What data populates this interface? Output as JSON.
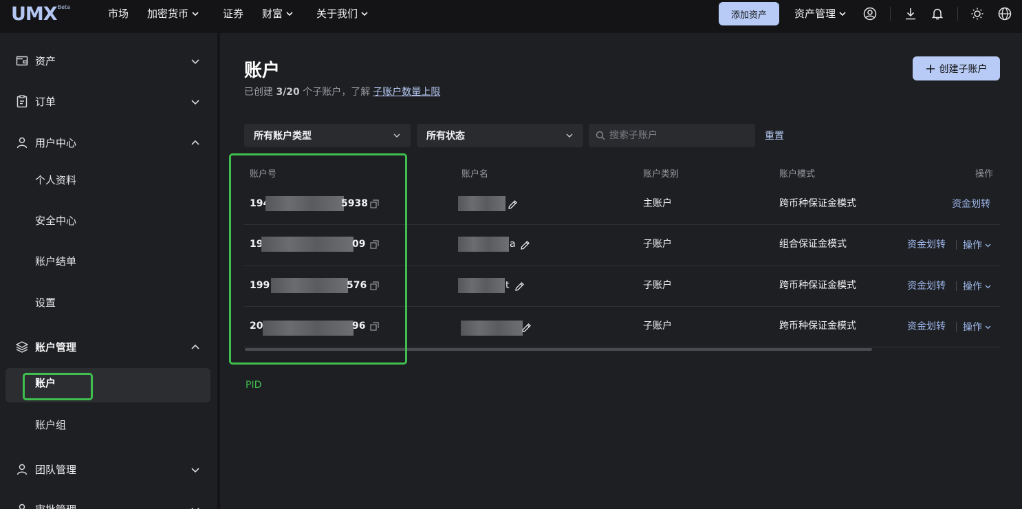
{
  "brand": {
    "logo": "UMX",
    "badge": "Beta",
    "accent": "#b7cbf6"
  },
  "topnav": {
    "items": [
      {
        "label": "市场",
        "has_dropdown": false
      },
      {
        "label": "加密货币",
        "has_dropdown": true
      },
      {
        "label": "证券",
        "has_dropdown": false
      },
      {
        "label": "财富",
        "has_dropdown": true
      },
      {
        "label": "关于我们",
        "has_dropdown": true
      }
    ],
    "add_asset_label": "添加资产",
    "asset_mgmt_label": "资产管理",
    "icons": [
      "user-icon",
      "download-icon",
      "bell-icon",
      "sun-icon",
      "globe-icon"
    ]
  },
  "sidebar": {
    "groups": [
      {
        "label": "资产",
        "icon": "wallet-icon",
        "expanded": false
      },
      {
        "label": "订单",
        "icon": "clipboard-icon",
        "expanded": false
      },
      {
        "label": "用户中心",
        "icon": "user-icon",
        "expanded": true,
        "children": [
          "个人资料",
          "安全中心",
          "账户结单",
          "设置"
        ]
      },
      {
        "label": "账户管理",
        "icon": "layers-icon",
        "expanded": true,
        "children": [
          "账户",
          "账户组"
        ],
        "active_child": "账户"
      },
      {
        "label": "团队管理",
        "icon": "user-icon",
        "expanded": false
      },
      {
        "label": "审批管理",
        "icon": "user-icon",
        "expanded": false
      }
    ]
  },
  "main": {
    "title": "账户",
    "subtitle_prefix": "已创建",
    "subtitle_count": "3/20",
    "subtitle_mid": "个子账户，了解",
    "subtitle_link": "子账户数量上限",
    "create_button": "创建子账户",
    "filters": {
      "account_type": "所有账户类型",
      "status": "所有状态",
      "search_placeholder": "搜索子账户",
      "reset": "重置"
    },
    "table": {
      "headers": [
        "账户号",
        "账户名",
        "账户类别",
        "账户模式",
        "操作"
      ],
      "rows": [
        {
          "acct_prefix": "194",
          "acct_suffix": "5938",
          "name_tail": "",
          "category": "主账户",
          "mode": "跨币种保证金模式",
          "transfer": "资金划转",
          "ops": ""
        },
        {
          "acct_prefix": "19",
          "acct_suffix": "09",
          "name_tail": "a",
          "category": "子账户",
          "mode": "组合保证金模式",
          "transfer": "资金划转",
          "ops": "操作"
        },
        {
          "acct_prefix": "199",
          "acct_suffix": "576",
          "name_tail": "t",
          "category": "子账户",
          "mode": "跨币种保证金模式",
          "transfer": "资金划转",
          "ops": "操作"
        },
        {
          "acct_prefix": "20",
          "acct_suffix": "96",
          "name_tail": "",
          "category": "子账户",
          "mode": "跨币种保证金模式",
          "transfer": "资金划转",
          "ops": "操作"
        }
      ]
    },
    "annotation": "PID",
    "highlight_color": "#3fbf4f"
  }
}
